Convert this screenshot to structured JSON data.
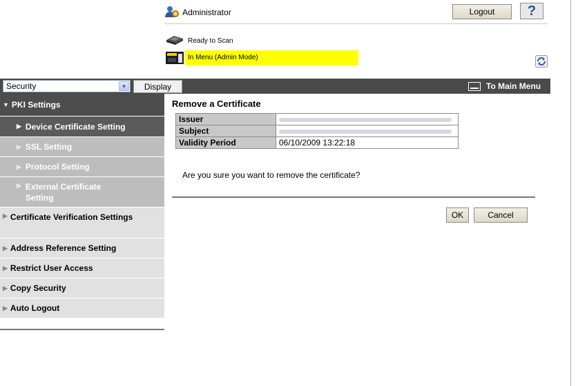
{
  "header": {
    "user_label": "Administrator",
    "logout_label": "Logout",
    "help_label": "?",
    "status_ready": "Ready to Scan",
    "status_menu": "In Menu (Admin Mode)"
  },
  "toolbar": {
    "category_selected": "Security",
    "display_label": "Display",
    "main_menu_label": "To Main Menu"
  },
  "sidebar": {
    "pki_label": "PKI Settings",
    "sub_items": [
      {
        "label": "Device Certificate Setting"
      },
      {
        "label": "SSL Setting"
      },
      {
        "label": "Protocol Setting"
      },
      {
        "label": "External Certificate Setting"
      }
    ],
    "items": [
      {
        "label": "Certificate Verification Settings"
      },
      {
        "label": "Address Reference Setting"
      },
      {
        "label": "Restrict User Access"
      },
      {
        "label": "Copy Security"
      },
      {
        "label": "Auto Logout"
      }
    ]
  },
  "content": {
    "title": "Remove a Certificate",
    "rows": [
      {
        "label": "Issuer",
        "value": ""
      },
      {
        "label": "Subject",
        "value": ""
      },
      {
        "label": "Validity Period",
        "value": "06/10/2009 13:22:18"
      }
    ],
    "question": "Are you sure you want to remove the certificate?",
    "ok_label": "OK",
    "cancel_label": "Cancel"
  },
  "colors": {
    "highlight": "#ffff00",
    "bar": "#4a4a4a",
    "active_item": "#5b5b5b",
    "sub_item": "#bdbdbd",
    "item": "#e1e1e1"
  }
}
